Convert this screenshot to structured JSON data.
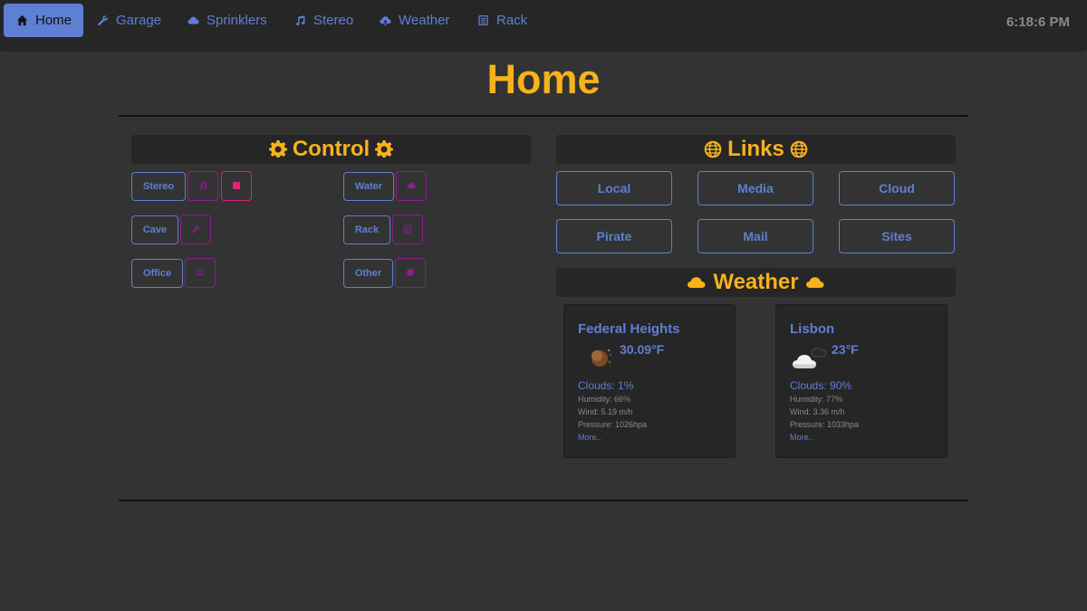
{
  "nav": {
    "items": [
      {
        "label": "Home",
        "icon": "home-icon"
      },
      {
        "label": "Garage",
        "icon": "wrench-icon"
      },
      {
        "label": "Sprinklers",
        "icon": "cloud-icon"
      },
      {
        "label": "Stereo",
        "icon": "music-note-icon"
      },
      {
        "label": "Weather",
        "icon": "cloud-upload-icon"
      },
      {
        "label": "Rack",
        "icon": "server-icon"
      }
    ],
    "clock": "6:18:6 PM"
  },
  "page": {
    "title": "Home"
  },
  "control": {
    "title": "Control",
    "icon": "gear-icon",
    "items": [
      {
        "label": "Stereo",
        "buttons": [
          "music-note-icon",
          "stop-icon"
        ]
      },
      {
        "label": "Water",
        "buttons": [
          "cloud-icon"
        ]
      },
      {
        "label": "Cave",
        "buttons": [
          "wrench-icon"
        ]
      },
      {
        "label": "Rack",
        "buttons": [
          "server-icon"
        ]
      },
      {
        "label": "Office",
        "buttons": [
          "laptop-icon"
        ]
      },
      {
        "label": "Other",
        "buttons": [
          "circle-icon"
        ]
      }
    ]
  },
  "links": {
    "title": "Links",
    "icon": "globe-icon",
    "items": [
      "Local",
      "Media",
      "Cloud",
      "Pirate",
      "Mail",
      "Sites"
    ]
  },
  "weather": {
    "title": "Weather",
    "icon": "cloud-icon",
    "cards": [
      {
        "city": "Federal Heights",
        "temp": "30.09°F",
        "icon": "clear-night-icon",
        "clouds": "Clouds: 1%",
        "humidity": "Humidity: 66%",
        "wind": "Wind: 5.19 m/h",
        "pressure": "Pressure: 1026hpa",
        "more": "More.."
      },
      {
        "city": "Lisbon",
        "temp": "23°F",
        "icon": "cloudy-night-icon",
        "clouds": "Clouds: 90%",
        "humidity": "Humidity: 77%",
        "wind": "Wind: 3.36 m/h",
        "pressure": "Pressure: 1033hpa",
        "more": "More.."
      }
    ]
  },
  "colors": {
    "accent": "#5f7fd3",
    "heading": "#f7b21c",
    "control_button": "#8a1f8f",
    "active_button": "#e0207a"
  }
}
